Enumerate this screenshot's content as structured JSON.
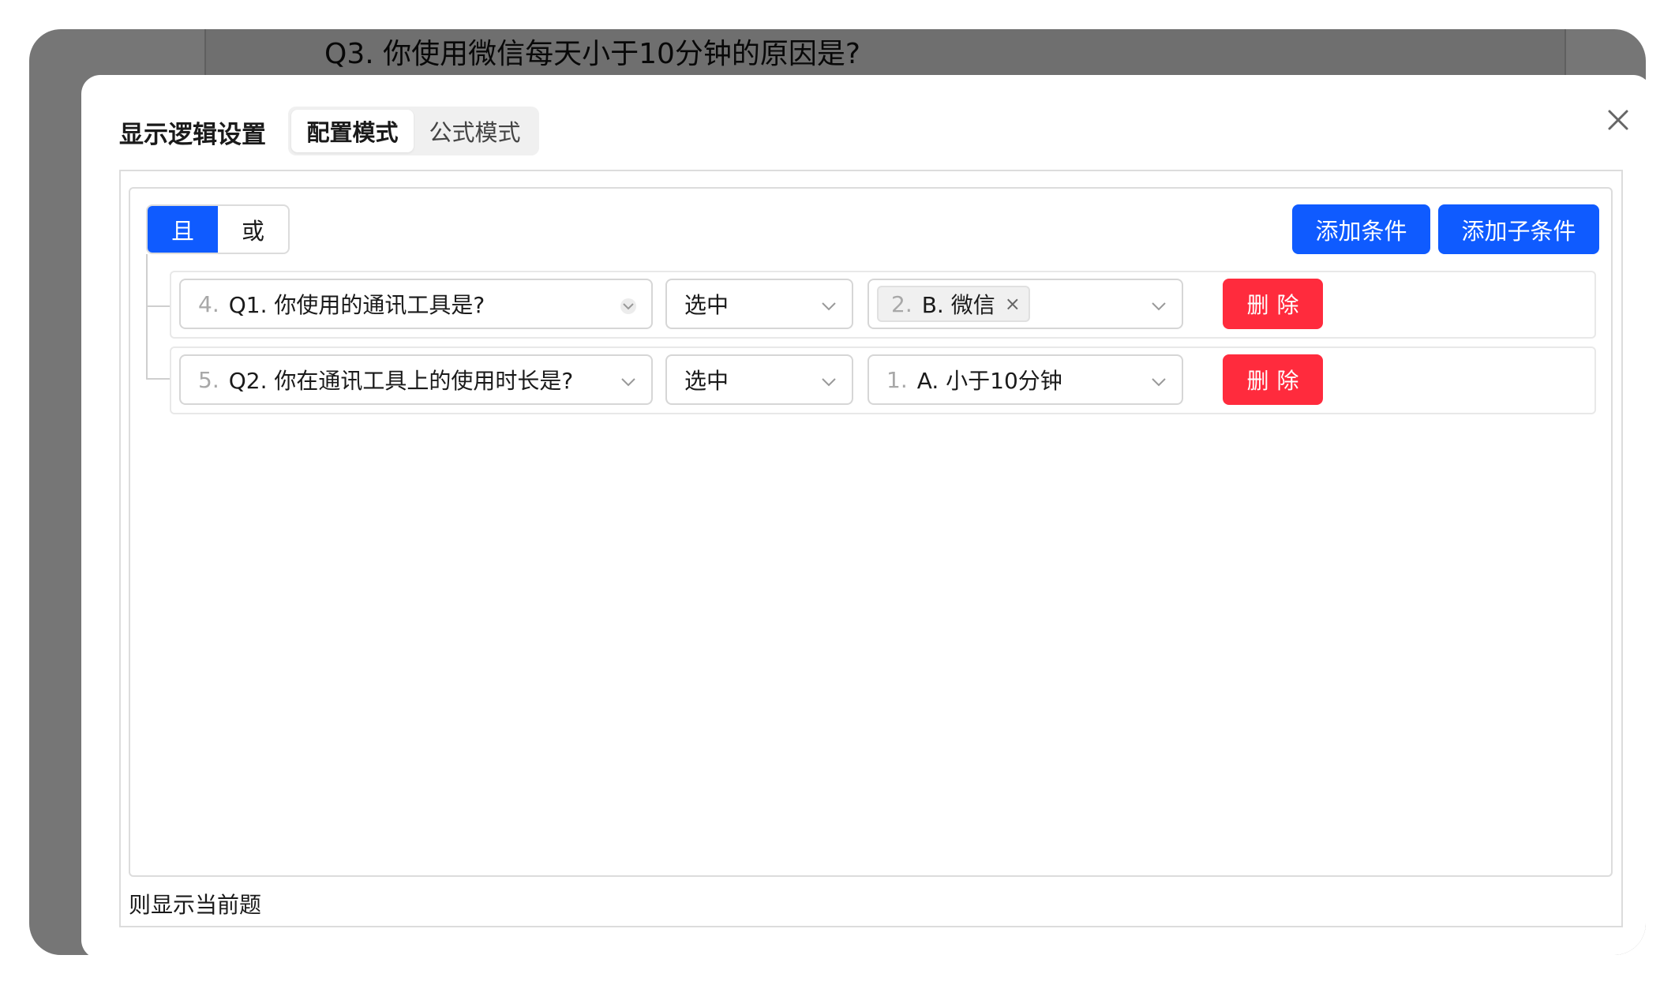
{
  "background": {
    "question_text": "Q3. 你使用微信每天小于10分钟的原因是?"
  },
  "modal": {
    "title": "显示逻辑设置",
    "tabs": [
      {
        "label": "配置模式",
        "active": true
      },
      {
        "label": "公式模式",
        "active": false
      }
    ],
    "logic": {
      "and_label": "且",
      "or_label": "或",
      "selected": "且"
    },
    "add_condition_label": "添加条件",
    "add_subcondition_label": "添加子条件",
    "conditions": [
      {
        "question_index": "4.",
        "question_text": "Q1. 你使用的通讯工具是?",
        "operator": "选中",
        "value_index": "2.",
        "value_text": "B. 微信",
        "value_is_tag": true,
        "delete_label": "删除"
      },
      {
        "question_index": "5.",
        "question_text": "Q2. 你在通讯工具上的使用时长是?",
        "operator": "选中",
        "value_index": "1.",
        "value_text": "A. 小于10分钟",
        "value_is_tag": false,
        "delete_label": "删除"
      }
    ],
    "footer_text": "则显示当前题"
  },
  "colors": {
    "primary": "#0f5bff",
    "danger": "#ff2b3d",
    "overlay": "#767676"
  }
}
